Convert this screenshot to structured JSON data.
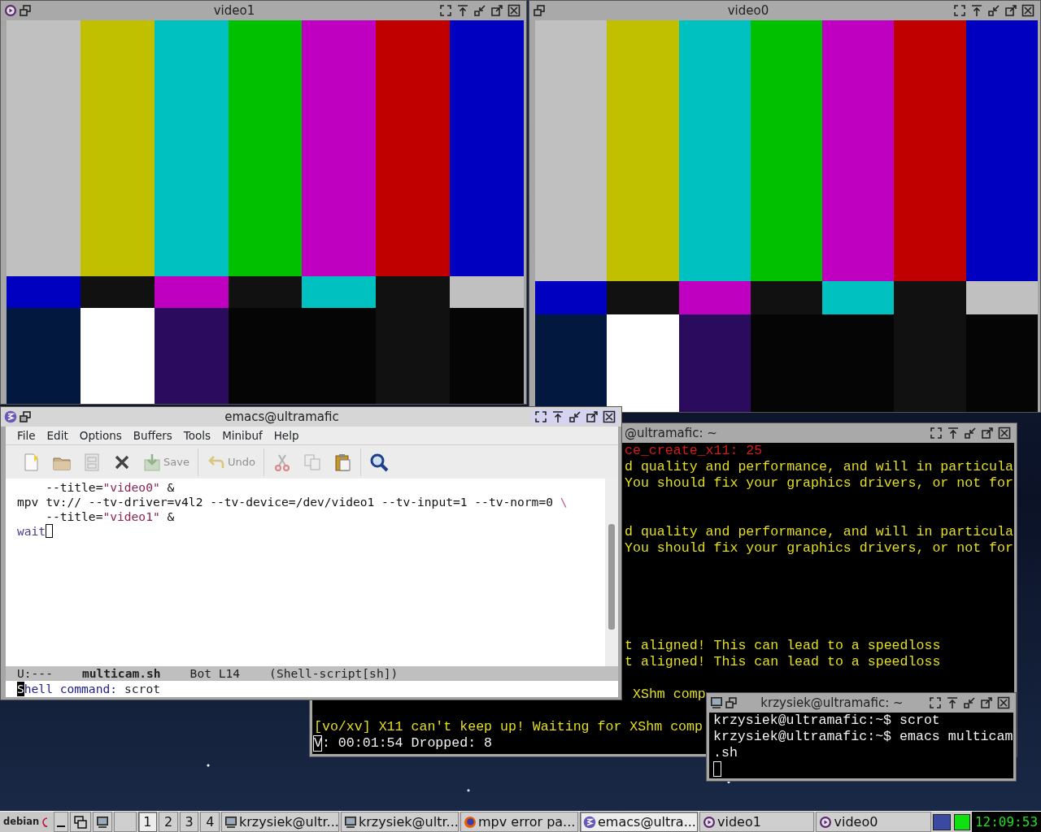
{
  "video_windows": [
    {
      "title": "video1"
    },
    {
      "title": "video0"
    }
  ],
  "mpv_terminal": {
    "title": "@ultramafic: ~",
    "blocks": [
      {
        "covered": true,
        "lines": [
          {
            "kind": "error",
            "text": "ce_create_x11: 25"
          },
          {
            "kind": "warning",
            "text": "d quality and performance, and will in particula"
          },
          {
            "kind": "warning",
            "text": "You should fix your graphics drivers, or not for"
          }
        ]
      },
      {
        "covered": true,
        "lines": [
          {
            "kind": "warning",
            "text": "d quality and performance, and will in particula"
          },
          {
            "kind": "warning",
            "text": "You should fix your graphics drivers, or not for"
          }
        ]
      },
      {
        "covered": true,
        "lines": [
          {
            "kind": "warning",
            "text": "t aligned! This can lead to a speedloss"
          },
          {
            "kind": "warning",
            "text": "t aligned! This can lead to a speedloss"
          }
        ]
      },
      {
        "covered": true,
        "lines": [
          {
            "kind": "warning",
            "text": "XShm comp"
          }
        ]
      },
      {
        "covered": false,
        "lines": [
          {
            "kind": "warning",
            "text": "[vo/xv] X11 can't keep up! Waiting for XShm comp"
          },
          {
            "kind": "status",
            "text": "V: 00:01:54 Dropped: 8",
            "cursor": true
          }
        ]
      }
    ]
  },
  "emacs": {
    "title": "emacs@ultramafic",
    "active": true,
    "menu": [
      "File",
      "Edit",
      "Options",
      "Buffers",
      "Tools",
      "Minibuf",
      "Help"
    ],
    "toolbar": [
      [
        {
          "kind": "new",
          "disabled": false
        },
        {
          "kind": "open",
          "disabled": false
        },
        {
          "kind": "save_file",
          "disabled": true
        },
        {
          "kind": "close",
          "disabled": false
        },
        {
          "kind": "save",
          "label": "Save",
          "disabled": true
        }
      ],
      [
        {
          "kind": "undo",
          "label": "Undo",
          "disabled": true
        }
      ],
      [
        {
          "kind": "cut",
          "disabled": true
        },
        {
          "kind": "copy",
          "disabled": true
        },
        {
          "kind": "paste",
          "disabled": false
        }
      ],
      [
        {
          "kind": "search",
          "disabled": false
        }
      ]
    ],
    "buffer_lines": [
      {
        "cursor": false,
        "segments": [
          {
            "kind": "plain",
            "text": "    --title="
          },
          {
            "kind": "string",
            "text": "\"video0\""
          },
          {
            "kind": "plain",
            "text": " &"
          }
        ]
      },
      {
        "cursor": false,
        "segments": [
          {
            "kind": "plain",
            "text": "mpv tv:// --tv-driver=v4l2 --tv-device=/dev/video1 --tv-input=1 --tv-norm=0 "
          },
          {
            "kind": "escape",
            "text": "\\"
          }
        ]
      },
      {
        "cursor": false,
        "segments": [
          {
            "kind": "plain",
            "text": "    --title="
          },
          {
            "kind": "string",
            "text": "\"video1\""
          },
          {
            "kind": "plain",
            "text": " &"
          }
        ]
      },
      {
        "cursor": true,
        "segments": [
          {
            "kind": "builtin",
            "text": "wait"
          }
        ]
      }
    ],
    "mode_line": {
      "status": "U:---",
      "buffer": "multicam.sh",
      "position": "Bot L14",
      "mode": "(Shell-script[sh])"
    },
    "minibuffer": {
      "prompt": "Shell command:",
      "value": "scrot",
      "cursor": true
    }
  },
  "shell_terminal": {
    "title": "krzysiek@ultramafic: ~",
    "lines": [
      "krzysiek@ultramafic:~$ scrot",
      "krzysiek@ultramafic:~$ emacs multicam",
      ".sh"
    ],
    "cursor": true
  },
  "taskbar": {
    "logo": "debian",
    "workspaces": [
      {
        "label": "1",
        "selected": true
      },
      {
        "label": "2",
        "selected": false
      },
      {
        "label": "3",
        "selected": false
      },
      {
        "label": "4",
        "selected": false
      }
    ],
    "tasks": [
      {
        "kind": "terminal",
        "label": "krzysiek@ultr...",
        "selected": false
      },
      {
        "kind": "terminal",
        "label": "krzysiek@ultr...",
        "selected": false
      },
      {
        "kind": "browser",
        "label": "mpv error pa...",
        "selected": false
      },
      {
        "kind": "emacs",
        "label": "emacs@ultra...",
        "selected": true
      },
      {
        "kind": "mpv",
        "label": "video1",
        "selected": false
      },
      {
        "kind": "mpv",
        "label": "video0",
        "selected": false
      }
    ],
    "clock": "12:09:53"
  }
}
